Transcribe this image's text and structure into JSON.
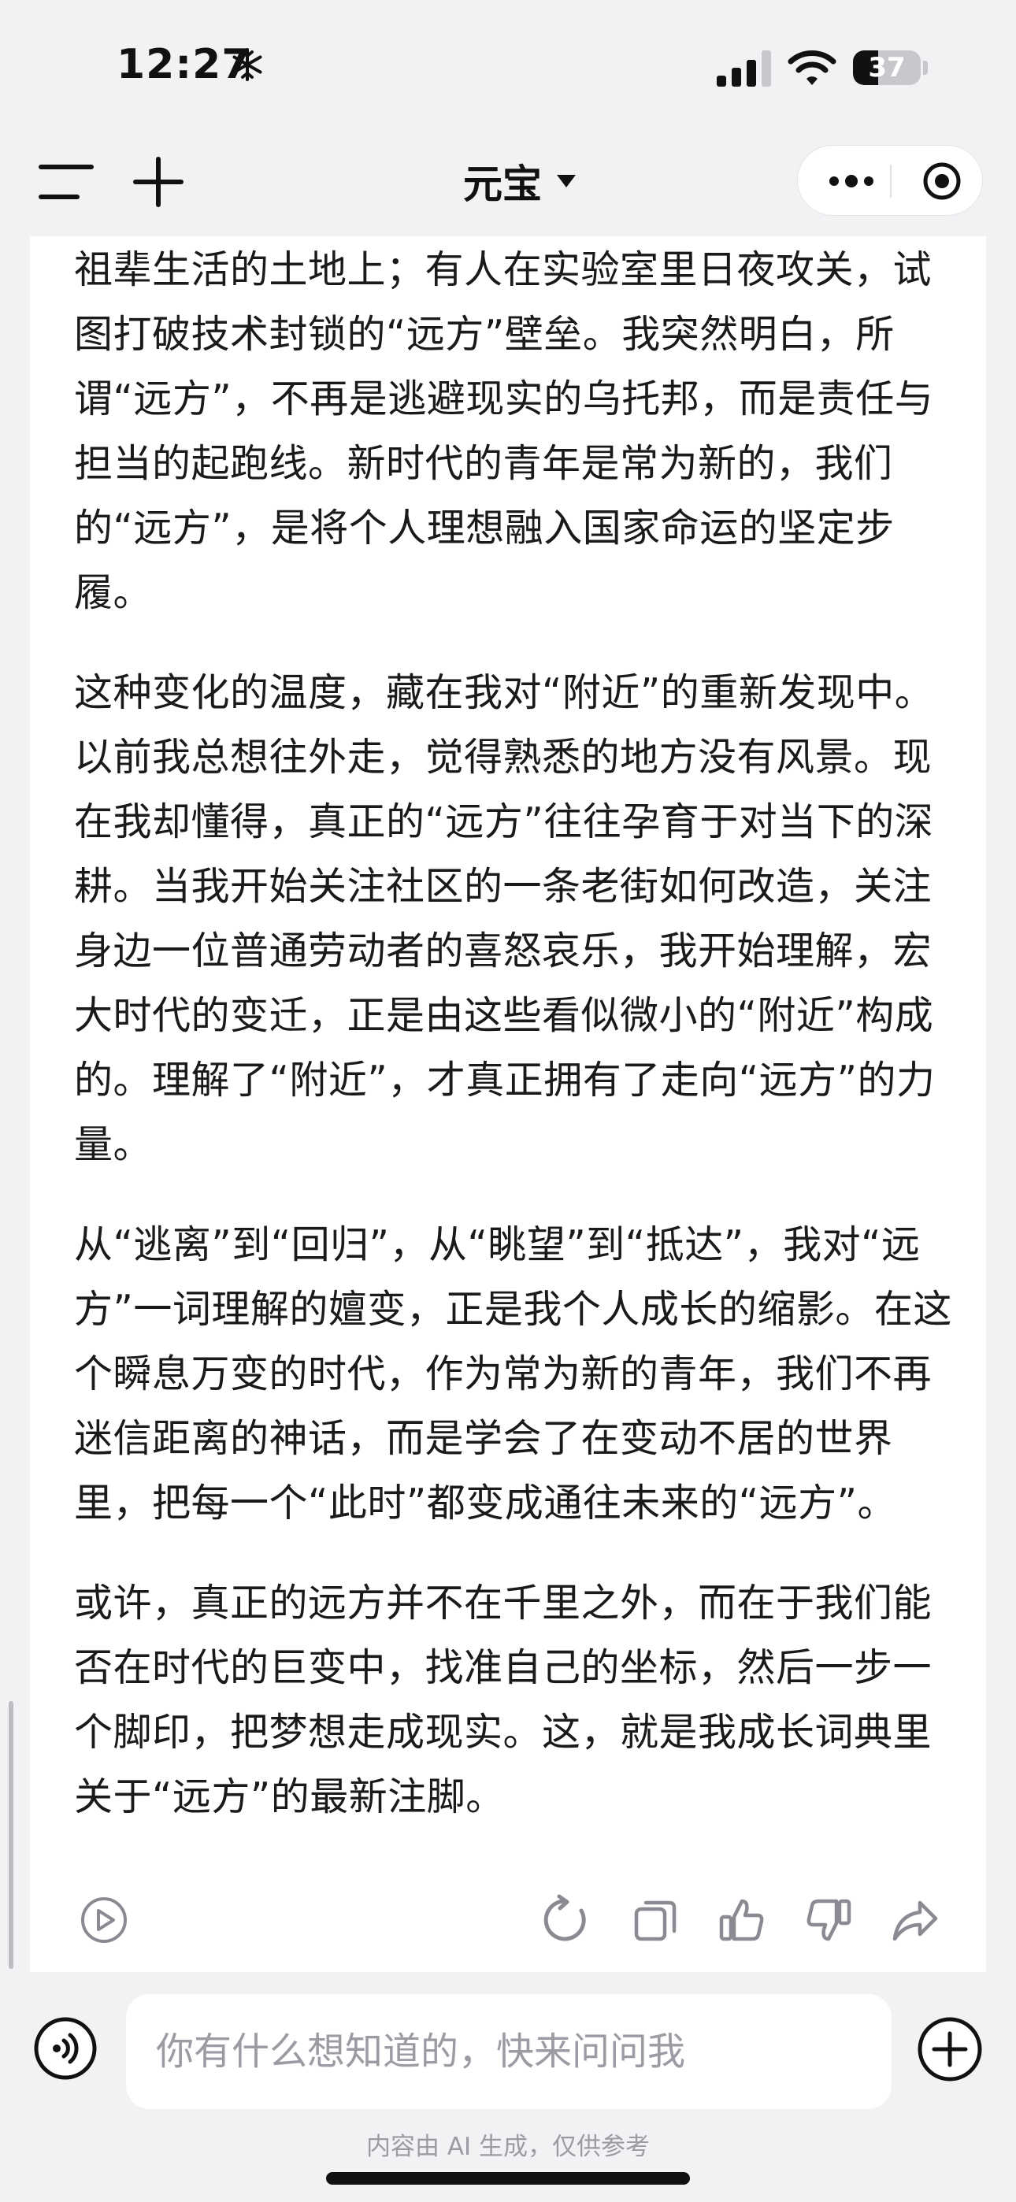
{
  "status_bar": {
    "time": "12:27",
    "battery_level": "37",
    "battery_fraction": 0.37
  },
  "nav": {
    "title": "元宝",
    "icons": {
      "left": [
        "menu-icon",
        "plus-icon"
      ],
      "title_caret": "caret-down-icon",
      "capsule": [
        "more-dots-icon",
        "target-close-icon"
      ]
    }
  },
  "message": {
    "paragraphs": [
      "祖辈生活的土地上；有人在实验室里日夜攻关，试图打破技术封锁的“远方”壁垒。我突然明白，所谓“远方”，不再是逃避现实的乌托邦，而是责任与担当的起跑线。新时代的青年是常为新的，我们的“远方”，是将个人理想融入国家命运的坚定步履。",
      "这种变化的温度，藏在我对“附近”的重新发现中。以前我总想往外走，觉得熟悉的地方没有风景。现在我却懂得，真正的“远方”往往孕育于对当下的深耕。当我开始关注社区的一条老街如何改造，关注身边一位普通劳动者的喜怒哀乐，我开始理解，宏大时代的变迁，正是由这些看似微小的“附近”构成的。理解了“附近”，才真正拥有了走向“远方”的力量。",
      "从“逃离”到“回归”，从“眺望”到“抵达”，我对“远方”一词理解的嬗变，正是我个人成长的缩影。在这个瞬息万变的时代，作为常为新的青年，我们不再迷信距离的神话，而是学会了在变动不居的世界里，把每一个“此时”都变成通往未来的“远方”。",
      "或许，真正的远方并不在千里之外，而在于我们能否在时代的巨变中，找准自己的坐标，然后一步一个脚印，把梦想走成现实。这，就是我成长词典里关于“远方”的最新注脚。"
    ],
    "actions": [
      "play-icon",
      "regenerate-icon",
      "copy-icon",
      "thumbs-up-icon",
      "thumbs-down-icon",
      "share-icon"
    ]
  },
  "input": {
    "placeholder": "你有什么想知道的，快来问问我",
    "value": "",
    "left_icon": "voice-icon",
    "right_icon": "plus-circle-icon"
  },
  "footer": {
    "disclaimer": "内容由 AI 生成，仅供参考"
  },
  "colors": {
    "page_background": "#f2f2f5",
    "card_background": "#ffffff",
    "text_primary": "#1a1a1a",
    "text_muted": "#9b9ba3",
    "icon_gray": "#8a8a92"
  }
}
